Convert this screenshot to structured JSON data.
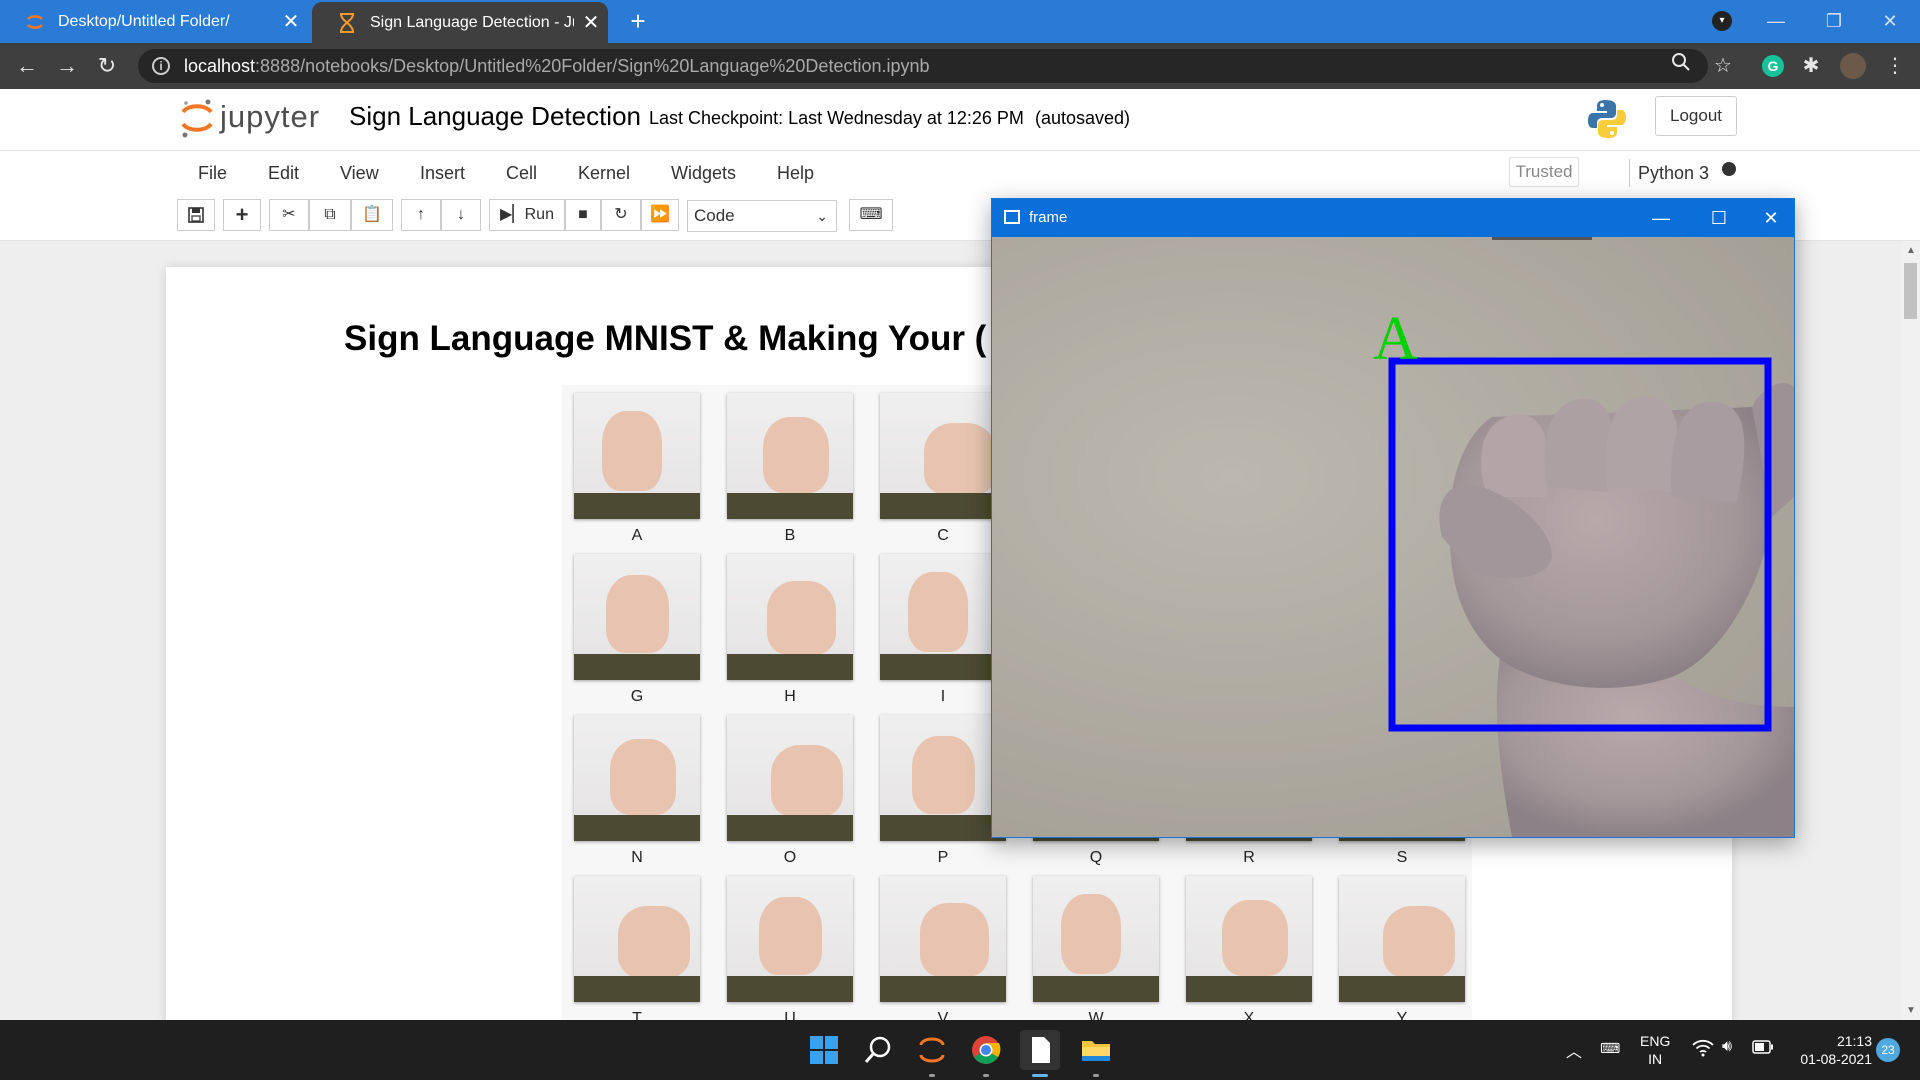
{
  "browser": {
    "tabs": [
      {
        "title": "Desktop/Untitled Folder/",
        "active": false
      },
      {
        "title": "Sign Language Detection - Jupyt",
        "active": true
      }
    ],
    "url_host": "localhost",
    "url_path": ":8888/notebooks/Desktop/Untitled%20Folder/Sign%20Language%20Detection.ipynb",
    "accent_color": "#2a7bd5"
  },
  "jupyter": {
    "logo_text": "jupyter",
    "notebook_name": "Sign Language Detection",
    "checkpoint": "Last Checkpoint: Last Wednesday at 12:26 PM",
    "autosave": "(autosaved)",
    "logout_label": "Logout",
    "menu": [
      "File",
      "Edit",
      "View",
      "Insert",
      "Cell",
      "Kernel",
      "Widgets",
      "Help"
    ],
    "trusted_label": "Trusted",
    "kernel_name": "Python 3",
    "toolbar": {
      "run_label": "Run",
      "cell_type": "Code"
    }
  },
  "notebook": {
    "heading": "Sign Language MNIST & Making Your (",
    "sign_labels": [
      "A",
      "B",
      "C",
      "G",
      "H",
      "I",
      "N",
      "O",
      "P",
      "Q",
      "R",
      "S",
      "T",
      "U",
      "V",
      "W",
      "X",
      "Y"
    ]
  },
  "frame_window": {
    "title": "frame",
    "prediction": "A",
    "box_color": "#0000ff",
    "prediction_color": "#00d000"
  },
  "taskbar": {
    "language_line1": "ENG",
    "language_line2": "IN",
    "time": "21:13",
    "date": "01-08-2021",
    "notification_count": "23"
  }
}
